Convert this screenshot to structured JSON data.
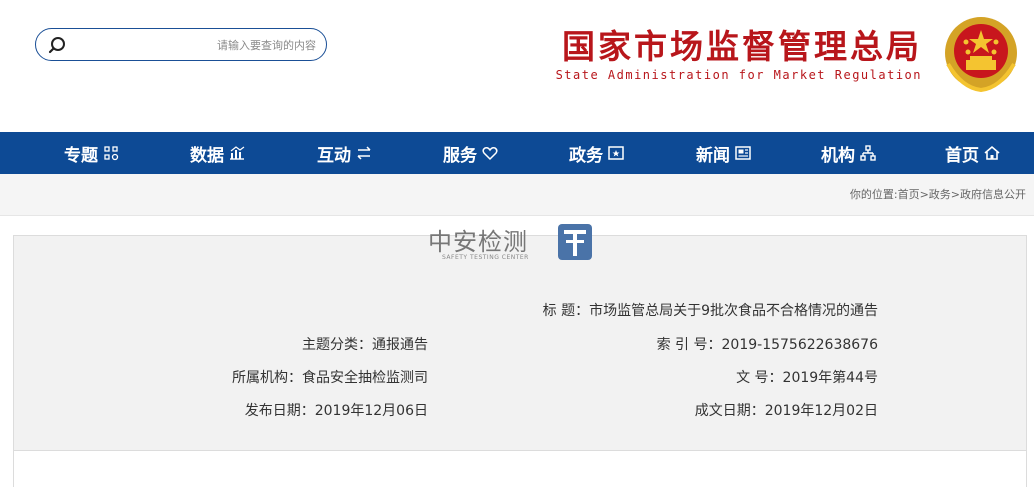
{
  "header": {
    "search_placeholder": "请输入要查询的内容",
    "title": "国家市场监督管理总局",
    "subtitle": "State Administration for Market Regulation"
  },
  "nav": {
    "items": [
      {
        "label": "首页",
        "icon": "home-icon"
      },
      {
        "label": "机构",
        "icon": "org-icon"
      },
      {
        "label": "新闻",
        "icon": "news-icon"
      },
      {
        "label": "政务",
        "icon": "gov-icon"
      },
      {
        "label": "服务",
        "icon": "heart-icon"
      },
      {
        "label": "互动",
        "icon": "exchange-icon"
      },
      {
        "label": "数据",
        "icon": "data-icon"
      },
      {
        "label": "专题",
        "icon": "topic-icon"
      }
    ]
  },
  "breadcrumb": {
    "text": "你的位置:首页>政务>政府信息公开"
  },
  "watermark": {
    "name": "中安检测",
    "english": "SAFETY TESTING CENTER"
  },
  "doc": {
    "title_label": "标 题：",
    "title_value": "市场监管总局关于9批次食品不合格情况的通告",
    "index_label": "索 引 号：",
    "index_value": "2019-1575622638676",
    "topic_label": "主题分类：",
    "topic_value": "通报通告",
    "number_label": "文 号：",
    "number_value": "2019年第44号",
    "org_label": "所属机构：",
    "org_value": "食品安全抽检监测司",
    "written_label": "成文日期：",
    "written_value": "2019年12月02日",
    "publish_label": "发布日期：",
    "publish_value": "2019年12月06日"
  }
}
